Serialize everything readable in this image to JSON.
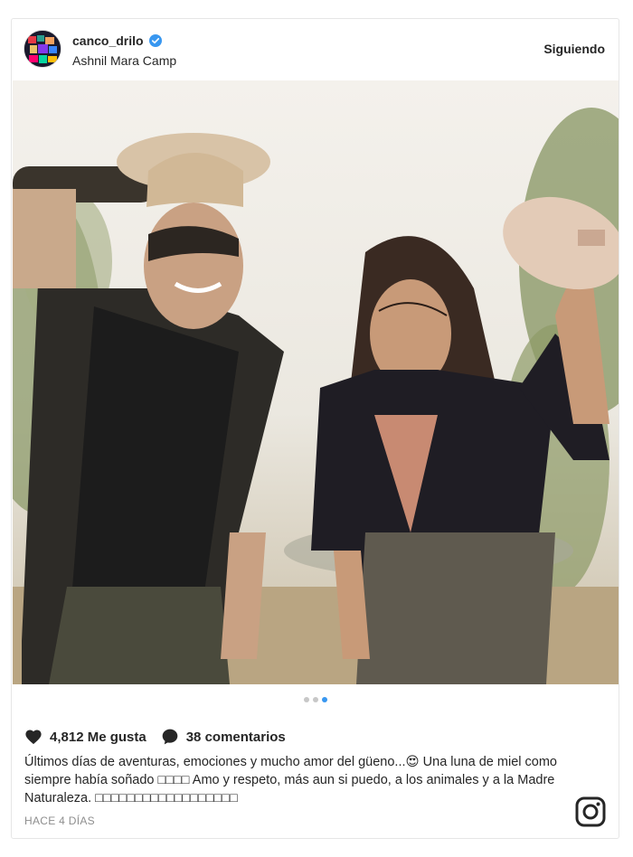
{
  "post": {
    "username": "canco_drilo",
    "verified": true,
    "location": "Ashnil Mara Camp",
    "follow_label": "Siguiendo",
    "likes": "4,812 Me gusta",
    "comments": "38 comentarios",
    "caption": "Últimos días de aventuras, emociones y mucho amor del güeno...😍 Una luna de miel como siempre había soñado □□□□ Amo y respeto, más aun si puedo, a los animales y a la Madre Naturaleza. □□□□□□□□□□□□□□□□□□",
    "time_ago": "HACE 4 DÍAS",
    "carousel": {
      "total": 3,
      "active_index": 2
    }
  },
  "icons": {
    "verified": "verified-badge-icon",
    "like": "heart-icon",
    "comment": "comment-bubble-icon",
    "brand": "instagram-icon"
  },
  "colors": {
    "accent": "#3897f0",
    "text": "#262626",
    "muted": "#8e8e8e"
  }
}
